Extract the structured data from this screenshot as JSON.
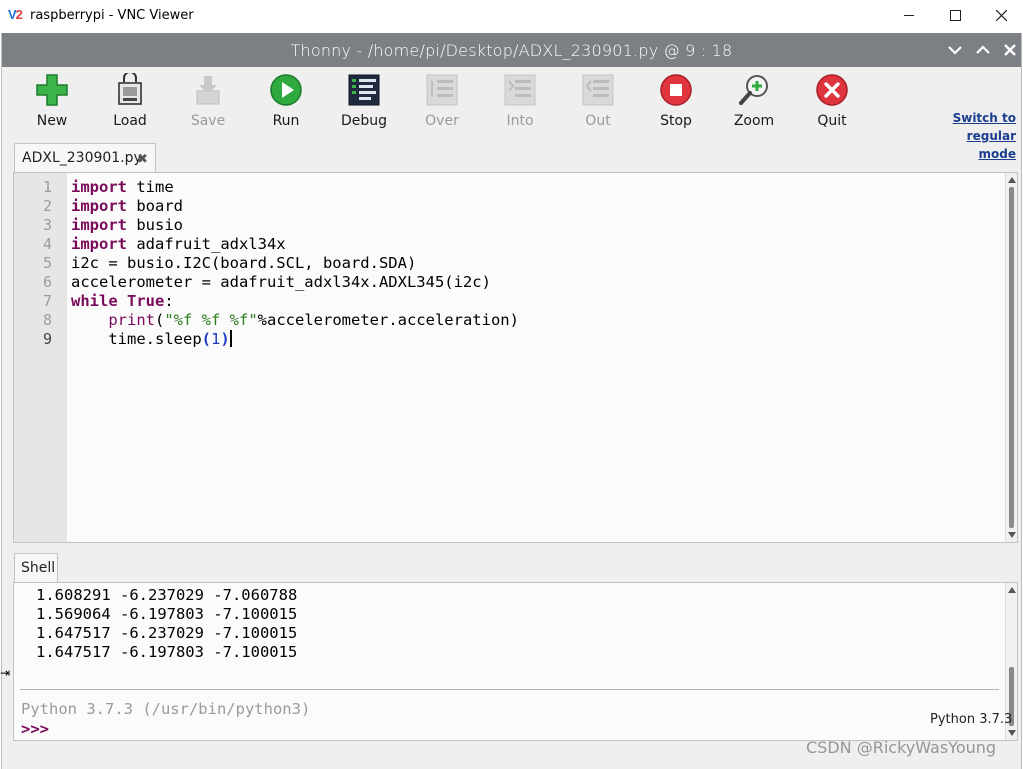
{
  "window": {
    "title": "raspberrypi - VNC Viewer",
    "logo": "V2"
  },
  "thonny": {
    "title": "Thonny  -  /home/pi/Desktop/ADXL_230901.py  @  9 : 18"
  },
  "toolbar": {
    "buttons": [
      {
        "label": "New",
        "icon": "new-file-icon",
        "enabled": true
      },
      {
        "label": "Load",
        "icon": "load-icon",
        "enabled": true
      },
      {
        "label": "Save",
        "icon": "save-icon",
        "enabled": false
      },
      {
        "label": "Run",
        "icon": "run-icon",
        "enabled": true
      },
      {
        "label": "Debug",
        "icon": "debug-icon",
        "enabled": true
      },
      {
        "label": "Over",
        "icon": "step-over-icon",
        "enabled": false
      },
      {
        "label": "Into",
        "icon": "step-into-icon",
        "enabled": false
      },
      {
        "label": "Out",
        "icon": "step-out-icon",
        "enabled": false
      },
      {
        "label": "Stop",
        "icon": "stop-icon",
        "enabled": true
      },
      {
        "label": "Zoom",
        "icon": "zoom-icon",
        "enabled": true
      },
      {
        "label": "Quit",
        "icon": "quit-icon",
        "enabled": true
      }
    ],
    "switch_mode": [
      "Switch to",
      "regular",
      "mode"
    ]
  },
  "editor": {
    "tab_label": "ADXL_230901.py",
    "line_numbers": [
      "1",
      "2",
      "3",
      "4",
      "5",
      "6",
      "7",
      "8",
      "9"
    ],
    "current_line": 9,
    "lines": [
      "import time",
      "import board",
      "import busio",
      "import adafruit_adxl34x",
      "i2c = busio.I2C(board.SCL, board.SDA)",
      "accelerometer = adafruit_adxl34x.ADXL345(i2c)",
      "while True:",
      "    print(\"%f %f %f\"%accelerometer.acceleration)",
      "    time.sleep(1)"
    ]
  },
  "shell": {
    "tab_label": "Shell",
    "output": [
      "1.608291 -6.237029 -7.060788",
      "1.569064 -6.197803 -7.100015",
      "1.647517 -6.237029 -7.100015",
      "1.647517 -6.197803 -7.100015"
    ],
    "version": "Python 3.7.3 (/usr/bin/python3)",
    "prompt": ">>>"
  },
  "status": {
    "interpreter": "Python 3.7.3"
  },
  "watermark": "CSDN @RickyWasYoung",
  "colors": {
    "thonny_title_bar": "#7c7f83",
    "keyword": "#7a0b5a",
    "string": "#2e7d20",
    "number": "#1f39c4",
    "run_green": "#2faa3f",
    "stop_red": "#e0343f"
  }
}
